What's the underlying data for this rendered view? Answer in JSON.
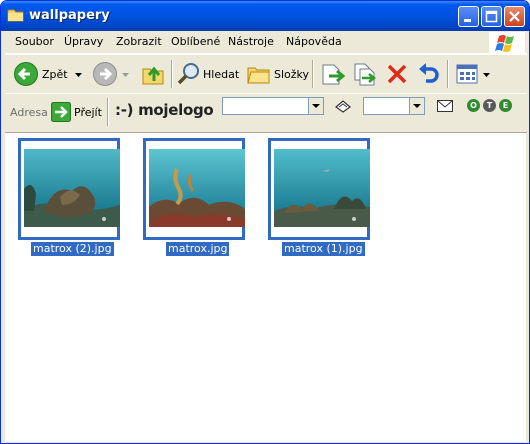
{
  "window": {
    "title": "wallpapery"
  },
  "menu": {
    "items": [
      "Soubor",
      "Úpravy",
      "Zobrazit",
      "Oblíbené",
      "Nástroje",
      "Nápověda"
    ]
  },
  "toolbar": {
    "back_label": "Zpět",
    "search_label": "Hledat",
    "folders_label": "Složky"
  },
  "address": {
    "label": "Adresa",
    "go_label": "Přejít"
  },
  "brand": {
    "logo_text": ":-) mojelogo",
    "badges": [
      "O",
      "T",
      "E"
    ]
  },
  "files": [
    {
      "name": "matrox (2).jpg"
    },
    {
      "name": "matrox.jpg"
    },
    {
      "name": "matrox (1).jpg"
    }
  ],
  "colors": {
    "selection": "#316AC5",
    "titlebar": "#0054E3",
    "chrome": "#ECE9D8"
  }
}
